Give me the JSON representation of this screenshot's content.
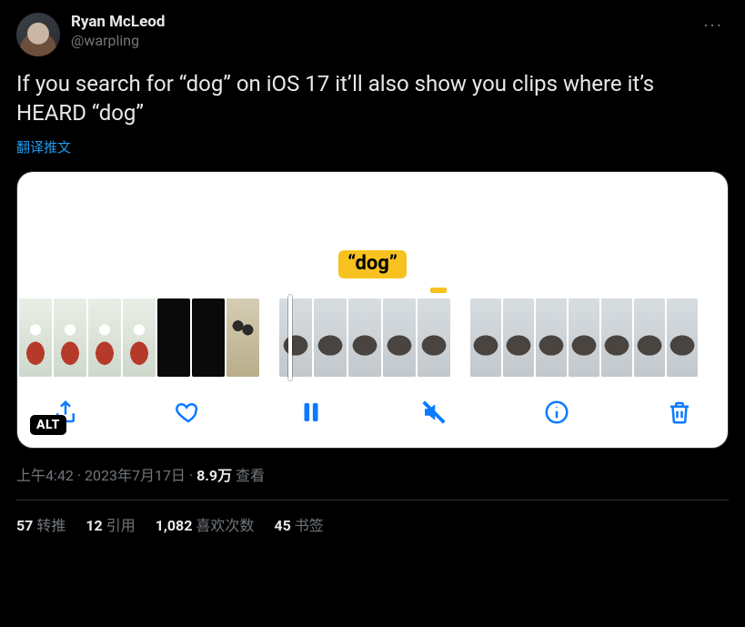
{
  "author": {
    "display_name": "Ryan McLeod",
    "handle": "@warpling"
  },
  "more_glyph": "···",
  "tweet_text": "If you search for “dog” on iOS 17 it’ll also show you clips where it’s HEARD “dog”",
  "translate_label": "翻译推文",
  "media": {
    "caption": "“dog”",
    "alt_badge": "ALT",
    "controls": {
      "share": "share-icon",
      "like": "heart-icon",
      "pause": "pause-icon",
      "mute": "mute-icon",
      "info": "info-icon",
      "trash": "trash-icon"
    }
  },
  "meta": {
    "time": "上午4:42",
    "sep": " · ",
    "date": "2023年7月17日",
    "views_count": "8.9万",
    "views_label": " 查看"
  },
  "stats": {
    "retweets_count": "57",
    "retweets_label": "转推",
    "quotes_count": "12",
    "quotes_label": "引用",
    "likes_count": "1,082",
    "likes_label": "喜欢次数",
    "bookmarks_count": "45",
    "bookmarks_label": "书签"
  }
}
